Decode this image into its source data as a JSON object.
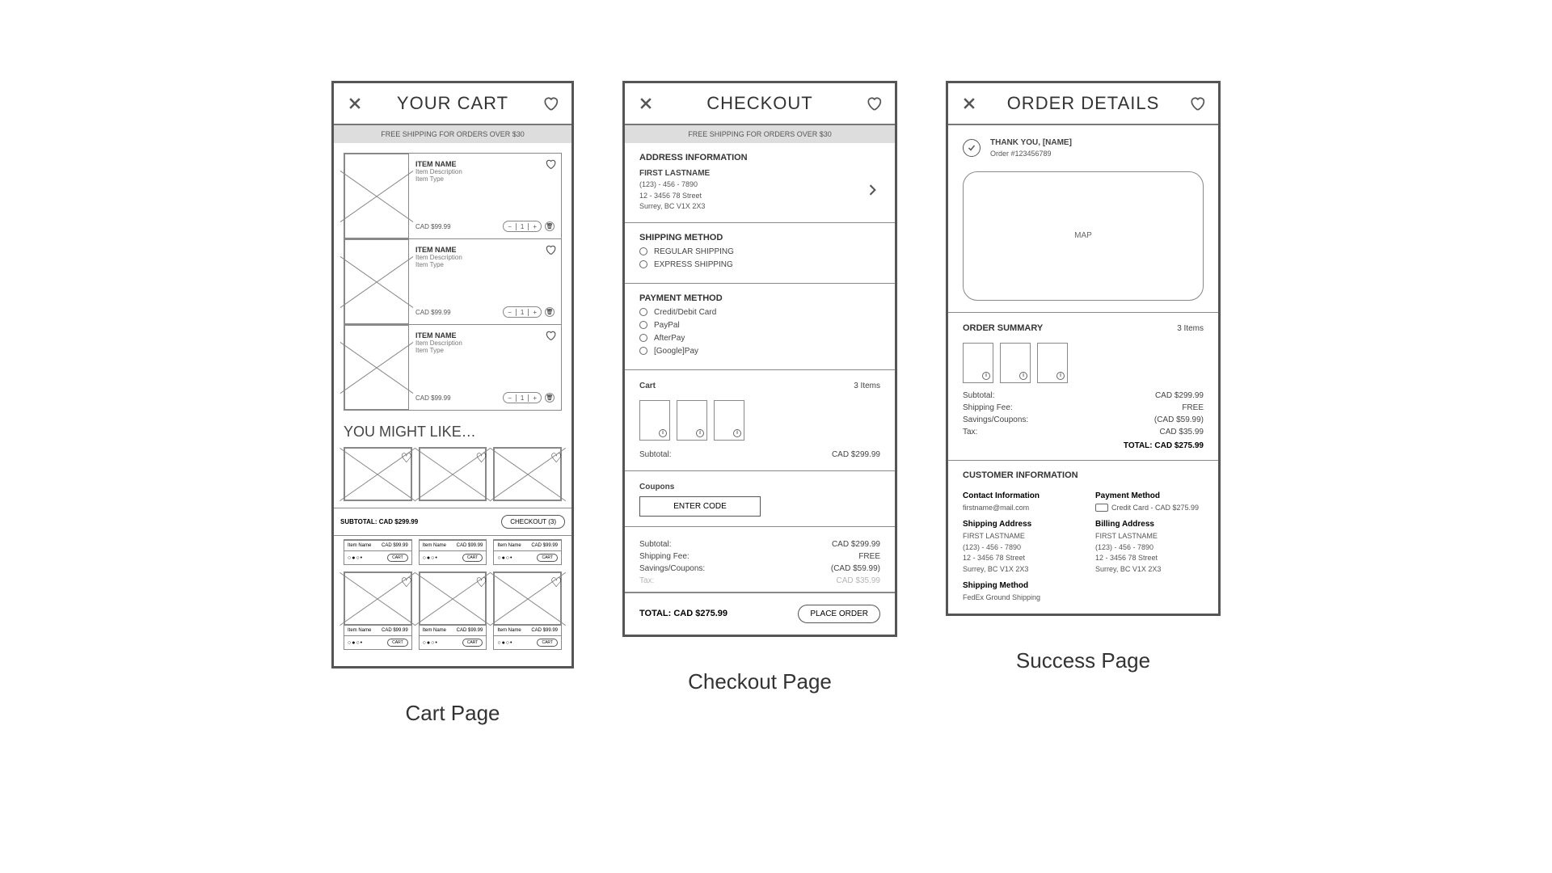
{
  "shipping_banner": "FREE SHIPPING FOR ORDERS OVER $30",
  "cart": {
    "title": "YOUR CART",
    "item_name": "ITEM NAME",
    "item_desc": "Item Description",
    "item_type": "Item Type",
    "item_price": "CAD $99.99",
    "minus": "−",
    "qty": "1",
    "plus": "+",
    "ymal": "YOU MIGHT LIKE…",
    "rec_name": "Item Name",
    "rec_price": "CAD $99.99",
    "cart_btn": "CART",
    "subtotal_label": "SUBTOTAL: CAD $299.99",
    "checkout_btn": "CHECKOUT (3)",
    "caption": "Cart Page"
  },
  "checkout": {
    "title": "CHECKOUT",
    "addr_heading": "ADDRESS INFORMATION",
    "name": "FIRST LASTNAME",
    "phone": "(123) - 456 - 7890",
    "street": "12 - 3456 78 Street",
    "city": "Surrey, BC V1X 2X3",
    "ship_heading": "SHIPPING METHOD",
    "ship_regular": "REGULAR SHIPPING",
    "ship_express": "EXPRESS SHIPPING",
    "pay_heading": "PAYMENT METHOD",
    "pay_cc": "Credit/Debit Card",
    "pay_pp": "PayPal",
    "pay_ap": "AfterPay",
    "pay_gp": "[Google]Pay",
    "cart_heading": "Cart",
    "items_count": "3 Items",
    "subtotal": "Subtotal:",
    "subtotal_val": "CAD $299.99",
    "coupons_heading": "Coupons",
    "enter_code": "ENTER CODE",
    "ship_fee": "Shipping Fee:",
    "ship_fee_val": "FREE",
    "savings": "Savings/Coupons:",
    "savings_val": "(CAD $59.99)",
    "tax": "Tax:",
    "tax_val": "CAD $35.99",
    "total": "TOTAL: CAD $275.99",
    "place_order": "PLACE ORDER",
    "caption": "Checkout Page"
  },
  "success": {
    "title": "ORDER DETAILS",
    "thankyou": "THANK YOU, [NAME]",
    "order_no": "Order #123456789",
    "map": "MAP",
    "summary_heading": "ORDER SUMMARY",
    "items_count": "3 Items",
    "subtotal": "Subtotal:",
    "subtotal_val": "CAD $299.99",
    "ship_fee": "Shipping Fee:",
    "ship_fee_val": "FREE",
    "savings": "Savings/Coupons:",
    "savings_val": "(CAD $59.99)",
    "tax": "Tax:",
    "tax_val": "CAD $35.99",
    "total": "TOTAL: CAD $275.99",
    "cust_heading": "CUSTOMER INFORMATION",
    "contact_h": "Contact Information",
    "email": "firstname@mail.com",
    "ship_addr_h": "Shipping Address",
    "name": "FIRST LASTNAME",
    "phone": "(123) - 456 - 7890",
    "street": "12 - 3456 78 Street",
    "city": "Surrey, BC V1X 2X3",
    "ship_method_h": "Shipping Method",
    "ship_method": "FedEx Ground Shipping",
    "pay_method_h": "Payment Method",
    "pay_method": "Credit Card - CAD $275.99",
    "bill_addr_h": "Billing Address",
    "caption": "Success Page"
  }
}
